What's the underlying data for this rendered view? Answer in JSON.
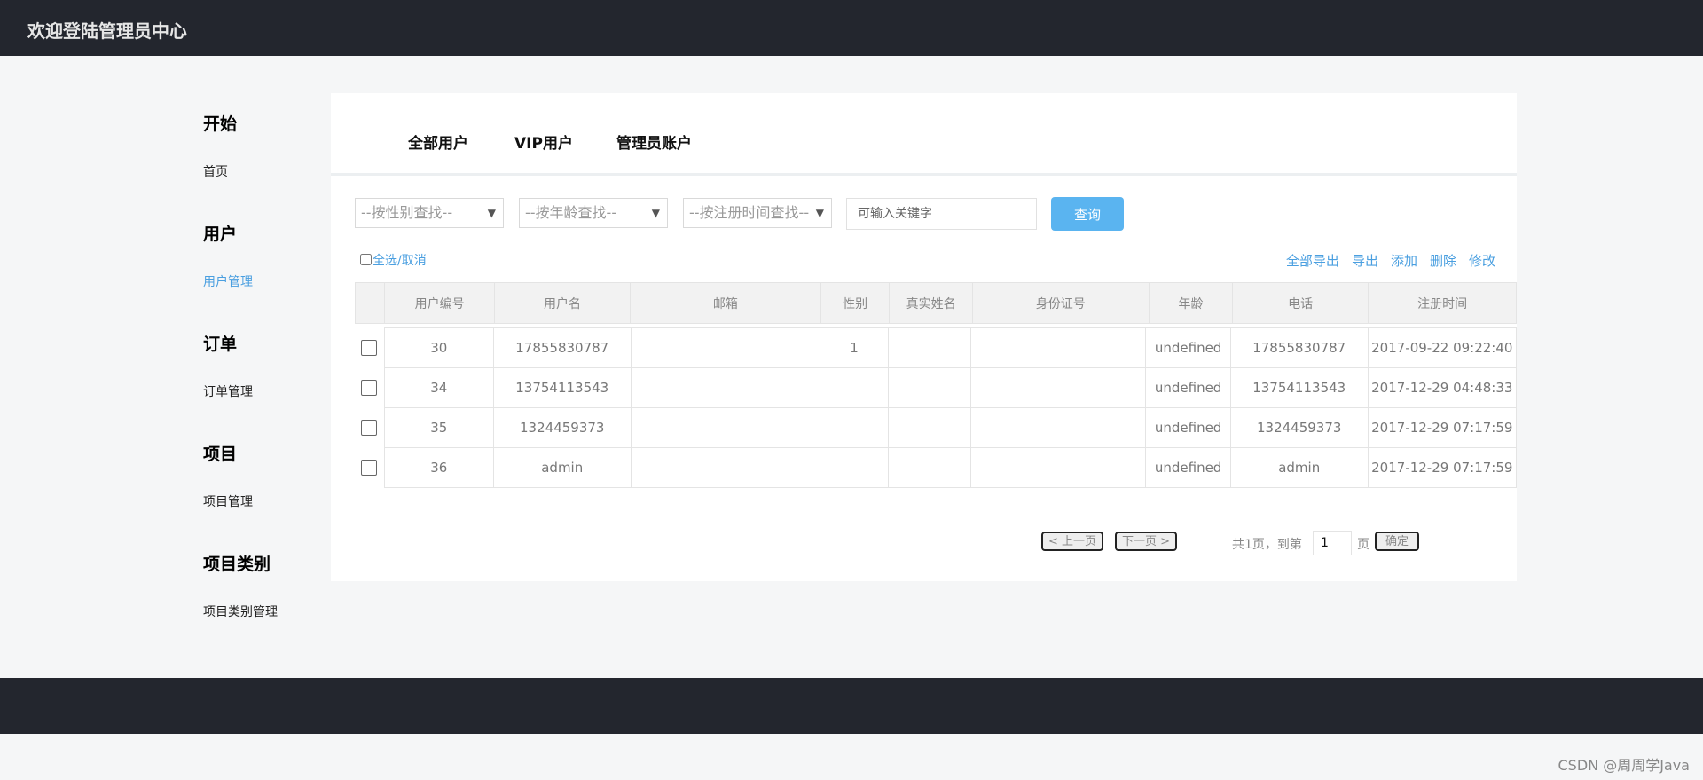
{
  "header": {
    "title": "欢迎登陆管理员中心"
  },
  "sidebar": {
    "groups": [
      {
        "title": "开始",
        "item": "首页"
      },
      {
        "title": "用户",
        "item": "用户管理"
      },
      {
        "title": "订单",
        "item": "订单管理"
      },
      {
        "title": "项目",
        "item": "项目管理"
      },
      {
        "title": "项目类别",
        "item": "项目类别管理"
      }
    ]
  },
  "tabs": [
    "全部用户",
    "VIP用户",
    "管理员账户"
  ],
  "filters": {
    "gender": "--按性别查找--",
    "age": "--按年龄查找--",
    "regtime": "--按注册时间查找--",
    "keyword_placeholder": "可输入关键字",
    "query_label": "查询"
  },
  "toolbar": {
    "select_all": "全选/取消",
    "actions": [
      "全部导出",
      "导出",
      "添加",
      "删除",
      "修改"
    ]
  },
  "table": {
    "columns": [
      "用户编号",
      "用户名",
      "邮箱",
      "性别",
      "真实姓名",
      "身份证号",
      "年龄",
      "电话",
      "注册时间"
    ],
    "rows": [
      [
        "30",
        "17855830787",
        "",
        "1",
        "",
        "",
        "undefined",
        "17855830787",
        "2017-09-22 09:22:40"
      ],
      [
        "34",
        "13754113543",
        "",
        "",
        "",
        "",
        "undefined",
        "13754113543",
        "2017-12-29 04:48:33"
      ],
      [
        "35",
        "1324459373",
        "",
        "",
        "",
        "",
        "undefined",
        "1324459373",
        "2017-12-29 07:17:59"
      ],
      [
        "36",
        "admin",
        "",
        "",
        "",
        "",
        "undefined",
        "admin",
        "2017-12-29 07:17:59"
      ]
    ]
  },
  "pager": {
    "prev": "< 上一页",
    "next": "下一页 >",
    "total": "共1页，到第",
    "page": "1",
    "page_unit": "页",
    "confirm": "确定"
  },
  "watermark": "CSDN @周周学Java"
}
